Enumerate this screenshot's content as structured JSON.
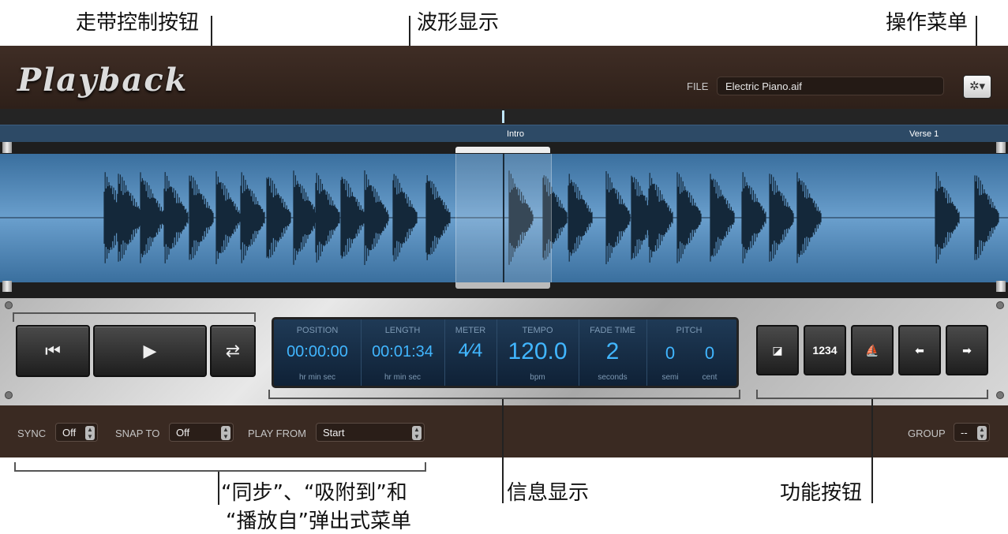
{
  "callouts": {
    "transport": "走带控制按钮",
    "waveform": "波形显示",
    "action_menu": "操作菜单",
    "popups_line1": "“同步”、“吸附到”和",
    "popups_line2": "“播放自”弹出式菜单",
    "info_display": "信息显示",
    "function_buttons": "功能按钮"
  },
  "header": {
    "logo": "Playback",
    "file_label": "FILE",
    "file_name": "Electric Piano.aif",
    "action_icon": "gear-icon",
    "action_glyph": "✲▾"
  },
  "markers": [
    "Intro",
    "Verse 1"
  ],
  "transport": {
    "prev_icon": "skip-to-start-icon",
    "prev_glyph": "⏮",
    "play_icon": "play-icon",
    "play_glyph": "▶",
    "cycle_icon": "cycle-icon",
    "cycle_glyph": "⇄"
  },
  "info": {
    "position": {
      "header": "POSITION",
      "value": "00:00:00",
      "sub": "hr   min   sec"
    },
    "length": {
      "header": "LENGTH",
      "value": "00:01:34",
      "sub": "hr   min   sec"
    },
    "meter": {
      "header": "METER",
      "value": "4⁄4"
    },
    "tempo": {
      "header": "TEMPO",
      "value": "120.0",
      "sub": "bpm"
    },
    "fade": {
      "header": "FADE TIME",
      "value": "2",
      "sub": "seconds"
    },
    "pitch": {
      "header": "PITCH",
      "semi_value": "0",
      "cent_value": "0",
      "semi_label": "semi",
      "cent_label": "cent"
    }
  },
  "function_buttons": [
    {
      "icon": "screen-icon",
      "glyph": "◪"
    },
    {
      "icon": "count-in-icon",
      "glyph": "1234"
    },
    {
      "icon": "metronome-icon",
      "glyph": "⛵"
    },
    {
      "icon": "move-left-icon",
      "glyph": "⬅"
    },
    {
      "icon": "move-right-icon",
      "glyph": "➡"
    }
  ],
  "bottom": {
    "sync_label": "SYNC",
    "sync_value": "Off",
    "snap_label": "SNAP TO",
    "snap_value": "Off",
    "play_from_label": "PLAY FROM",
    "play_from_value": "Start",
    "group_label": "GROUP",
    "group_value": "--"
  },
  "colors": {
    "accent": "#41b6ff",
    "waveform": "#6a9fcd",
    "wood": "#3a2a22"
  }
}
